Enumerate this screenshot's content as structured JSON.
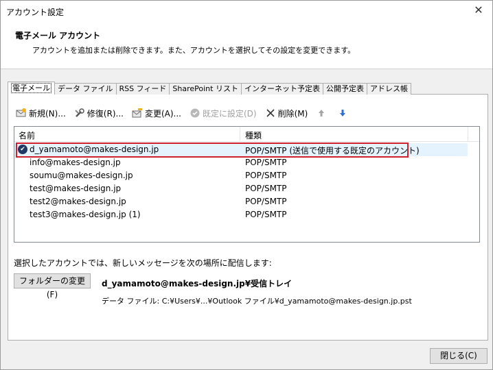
{
  "window": {
    "title": "アカウント設定"
  },
  "header": {
    "title": "電子メール アカウント",
    "description": "アカウントを追加または削除できます。また、アカウントを選択してその設定を変更できます。"
  },
  "tabs": [
    {
      "label": "電子メール",
      "active": true
    },
    {
      "label": "データ ファイル"
    },
    {
      "label": "RSS フィード"
    },
    {
      "label": "SharePoint リスト"
    },
    {
      "label": "インターネット予定表"
    },
    {
      "label": "公開予定表"
    },
    {
      "label": "アドレス帳"
    }
  ],
  "toolbar": {
    "new": "新規(N)...",
    "repair": "修復(R)...",
    "change": "変更(A)...",
    "set_default": "既定に設定(D)",
    "delete": "削除(M)"
  },
  "list": {
    "headers": {
      "name": "名前",
      "type": "種類"
    },
    "rows": [
      {
        "name": "d_yamamoto@makes-design.jp",
        "type": "POP/SMTP (送信で使用する既定のアカウント)",
        "default": true
      },
      {
        "name": "info@makes-design.jp",
        "type": "POP/SMTP"
      },
      {
        "name": "soumu@makes-design.jp",
        "type": "POP/SMTP"
      },
      {
        "name": "test@makes-design.jp",
        "type": "POP/SMTP"
      },
      {
        "name": "test2@makes-design.jp",
        "type": "POP/SMTP"
      },
      {
        "name": "test3@makes-design.jp (1)",
        "type": "POP/SMTP"
      }
    ]
  },
  "delivery": {
    "label": "選択したアカウントでは、新しいメッセージを次の場所に配信します:",
    "change_folder_button": "フォルダーの変更(F)",
    "target": "d_yamamoto@makes-design.jp¥受信トレイ",
    "data_file": "データ ファイル: C:¥Users¥...¥Outlook ファイル¥d_yamamoto@makes-design.jp.pst"
  },
  "footer": {
    "close_button": "閉じる(C)"
  },
  "colors": {
    "highlight": "#d0202e",
    "selected_row": "#e5f3ff"
  }
}
